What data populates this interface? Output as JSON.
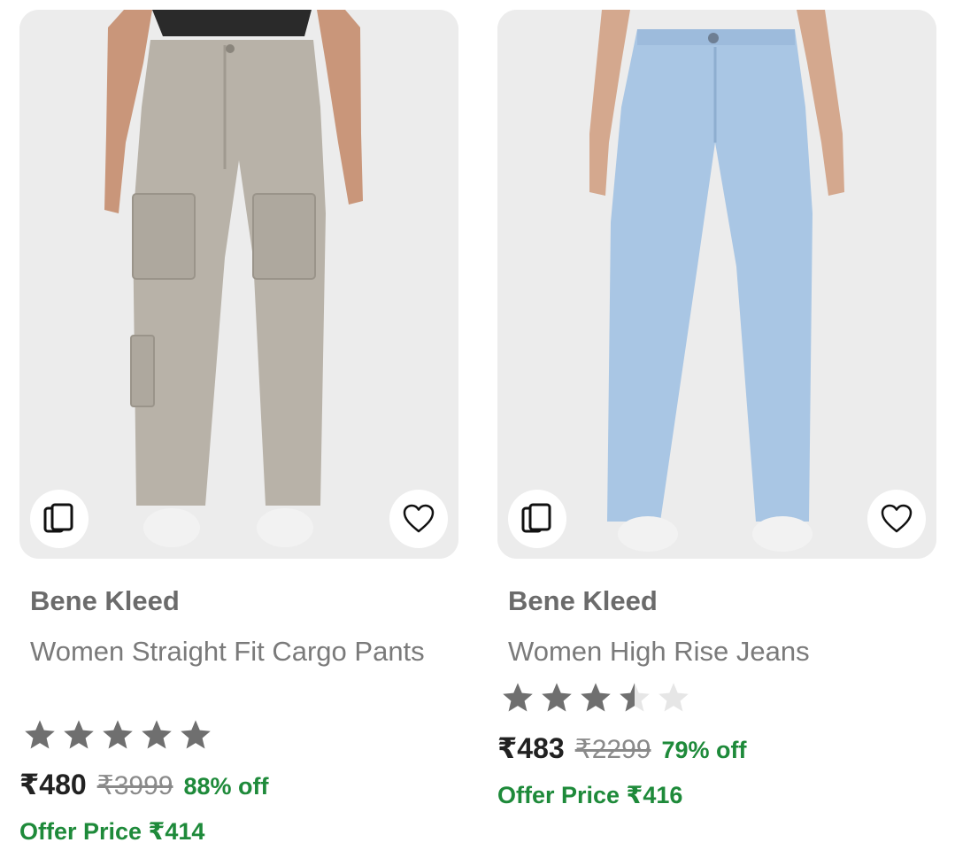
{
  "colors": {
    "image_bg": "#ececec",
    "brand_text": "#6b6b6b",
    "title_text": "#7a7a7a",
    "price_text": "#212121",
    "mrp_text": "#8a8a8a",
    "discount_green": "#1e8a3a",
    "star_filled": "#6f6f6f",
    "star_empty": "#e6e6e6"
  },
  "products": [
    {
      "image_icon": "cargo-pants-image",
      "compare_icon": "compare-cards-icon",
      "wishlist_icon": "heart-outline-icon",
      "brand": "Bene Kleed",
      "title": "Women Straight Fit Cargo Pants",
      "rating": 5,
      "price": "₹480",
      "mrp": "₹3999",
      "discount": "88% off",
      "offer": "Offer Price ₹414"
    },
    {
      "image_icon": "high-rise-jeans-image",
      "compare_icon": "compare-cards-icon",
      "wishlist_icon": "heart-outline-icon",
      "brand": "Bene Kleed",
      "title": "Women High Rise Jeans",
      "rating": 3.5,
      "price": "₹483",
      "mrp": "₹2299",
      "discount": "79% off",
      "offer": "Offer Price ₹416"
    }
  ]
}
